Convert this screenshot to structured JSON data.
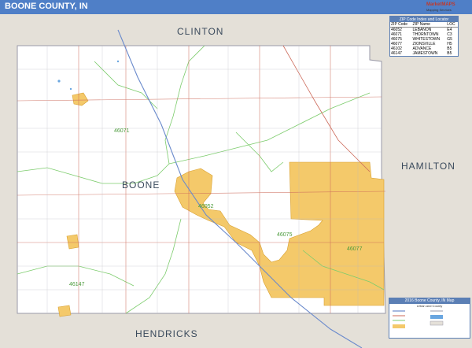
{
  "title": "BOONE COUNTY, IN",
  "colors": {
    "title_bar": "#4f7fc7",
    "surrounding_counties": "#e4e0d8",
    "county_fill": "#ffffff",
    "urban_area": "#f4c96a",
    "zip_boundary": "#7ccc6c",
    "roads": "#cc6a5a",
    "water": "#6aa6e0"
  },
  "neighbor_counties": [
    "CLINTON",
    "HAMILTON",
    "HENDRICKS"
  ],
  "county_name": "BOONE",
  "zip_labels": [
    "46071",
    "46052",
    "46075",
    "46077",
    "46147"
  ],
  "zip_table": {
    "title": "ZIP Code Index and Locator",
    "headers": [
      "ZIP Code",
      "ZIP Name",
      "LOC"
    ],
    "rows": [
      [
        "46052",
        "LEBANON",
        "E4"
      ],
      [
        "46071",
        "THORNTOWN",
        "C3"
      ],
      [
        "46075",
        "WHITESTOWN",
        "G5"
      ],
      [
        "46077",
        "ZIONSVILLE",
        "H5"
      ],
      [
        "46102",
        "ADVANCE",
        "B5"
      ],
      [
        "46147",
        "JAMESTOWN",
        "B5"
      ]
    ]
  },
  "legend": {
    "title": "2016 Boone County, IN Map",
    "subtitle": "Urban and County"
  },
  "logo": {
    "name": "MarketMAPS",
    "subtitle": "Mapping Services"
  }
}
